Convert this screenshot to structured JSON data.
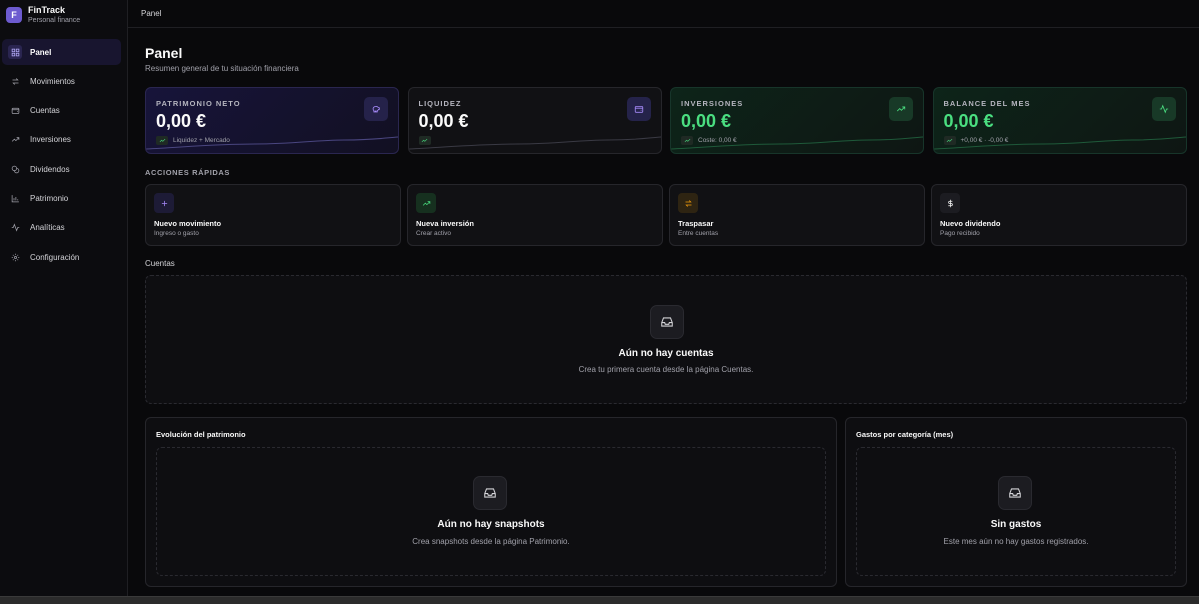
{
  "brand": {
    "logo_letter": "F",
    "name": "FinTrack",
    "subtitle": "Personal finance"
  },
  "sidebar": {
    "items": [
      {
        "label": "Panel",
        "icon": "grid-icon",
        "active": true
      },
      {
        "label": "Movimientos",
        "icon": "arrows-icon"
      },
      {
        "label": "Cuentas",
        "icon": "wallet-icon"
      },
      {
        "label": "Inversiones",
        "icon": "trending-up-icon"
      },
      {
        "label": "Dividendos",
        "icon": "coins-icon"
      },
      {
        "label": "Patrimonio",
        "icon": "bar-chart-icon"
      },
      {
        "label": "Analíticas",
        "icon": "activity-icon"
      },
      {
        "label": "Configuración",
        "icon": "gear-icon"
      }
    ]
  },
  "topbar": {
    "breadcrumb": "Panel"
  },
  "header": {
    "title": "Panel",
    "subtitle": "Resumen general de tu situación financiera"
  },
  "stats": [
    {
      "label": "PATRIMONIO NETO",
      "value": "0,00 €",
      "foot": "Liquidez + Mercado",
      "icon": "piggy-bank-icon",
      "accent": "#a78bfa"
    },
    {
      "label": "LIQUIDEZ",
      "value": "0,00 €",
      "foot": "",
      "icon": "wallet-icon",
      "accent": "#a78bfa"
    },
    {
      "label": "INVERSIONES",
      "value": "0,00 €",
      "foot": "Coste: 0,00 €",
      "icon": "trending-up-icon",
      "accent": "#4ade80"
    },
    {
      "label": "BALANCE DEL MES",
      "value": "0,00 €",
      "foot": "+0,00 € · -0,00 €",
      "icon": "activity-icon",
      "accent": "#4ade80"
    }
  ],
  "quick_actions": {
    "heading": "ACCIONES RÁPIDAS",
    "items": [
      {
        "title": "Nuevo movimiento",
        "subtitle": "Ingreso o gasto",
        "icon": "plus-icon",
        "accent": "#a78bfa"
      },
      {
        "title": "Nueva inversión",
        "subtitle": "Crear activo",
        "icon": "trending-up-icon",
        "accent": "#4ade80"
      },
      {
        "title": "Traspasar",
        "subtitle": "Entre cuentas",
        "icon": "transfer-icon",
        "accent": "#f59e0b"
      },
      {
        "title": "Nuevo dividendo",
        "subtitle": "Pago recibido",
        "icon": "dollar-icon",
        "accent": "#fafafa"
      }
    ]
  },
  "accounts": {
    "heading": "Cuentas",
    "empty_title": "Aún no hay cuentas",
    "empty_subtitle": "Crea tu primera cuenta desde la página Cuentas."
  },
  "net_worth_panel": {
    "title": "Evolución del patrimonio",
    "empty_title": "Aún no hay snapshots",
    "empty_subtitle": "Crea snapshots desde la página Patrimonio."
  },
  "expenses_panel": {
    "title": "Gastos por categoría (mes)",
    "empty_title": "Sin gastos",
    "empty_subtitle": "Este mes aún no hay gastos registrados."
  }
}
